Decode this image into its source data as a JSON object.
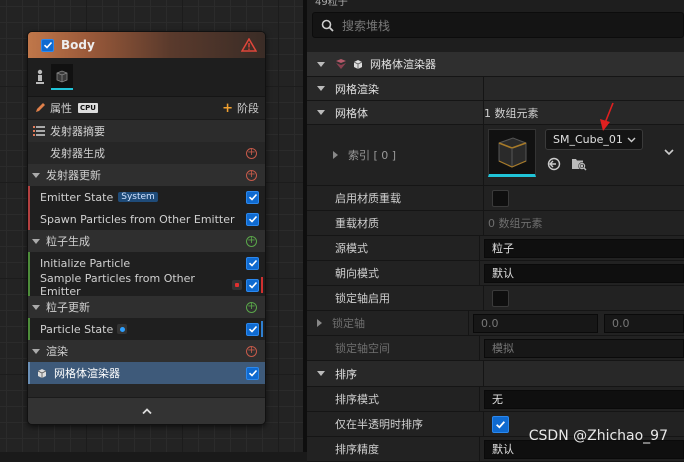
{
  "node": {
    "title": "Body",
    "properties_label": "属性",
    "cpu_badge": "CPU",
    "stage_label": "阶段",
    "summary_label": "发射器摘要",
    "emitter_spawn": "发射器生成",
    "emitter_update": "发射器更新",
    "emitter_state": "Emitter State",
    "system_badge": "System",
    "spawn_from_emitter": "Spawn Particles from Other Emitter",
    "particle_spawn": "粒子生成",
    "initialize_particle": "Initialize Particle",
    "sample_particles": "Sample Particles from Other Emitter",
    "particle_update": "粒子更新",
    "particle_state": "Particle State",
    "render": "渲染",
    "mesh_renderer": "网格体渲染器"
  },
  "panel": {
    "top_text": "49粒子",
    "search_placeholder": "搜索堆栈",
    "renderer_title": "网格体渲染器",
    "mesh_render": "网格渲染",
    "meshes_label": "网格体",
    "meshes_value": "1 数组元素",
    "index_label": "索引 [ 0 ]",
    "mesh_asset": "SM_Cube_01",
    "enable_override": "启用材质重载",
    "override_materials": "重载材质",
    "override_materials_value": "0 数组元素",
    "source_mode": "源模式",
    "source_mode_value": "粒子",
    "facing_mode": "朝向模式",
    "facing_mode_value": "默认",
    "locked_axis_enable": "锁定轴启用",
    "locked_axis": "锁定轴",
    "locked_axis_x": "0.0",
    "locked_axis_y": "0.0",
    "locked_axis_space": "锁定轴空间",
    "locked_axis_space_value": "模拟",
    "sorting": "排序",
    "sort_mode": "排序模式",
    "sort_mode_value": "无",
    "sort_translucent": "仅在半透明时排序",
    "sort_precision": "排序精度",
    "sort_precision_value": "默认"
  },
  "watermark": "CSDN @Zhichao_97",
  "colors": {
    "accent": "#0f6ad0",
    "arrow": "#e02020",
    "teal": "#20c4d8"
  }
}
